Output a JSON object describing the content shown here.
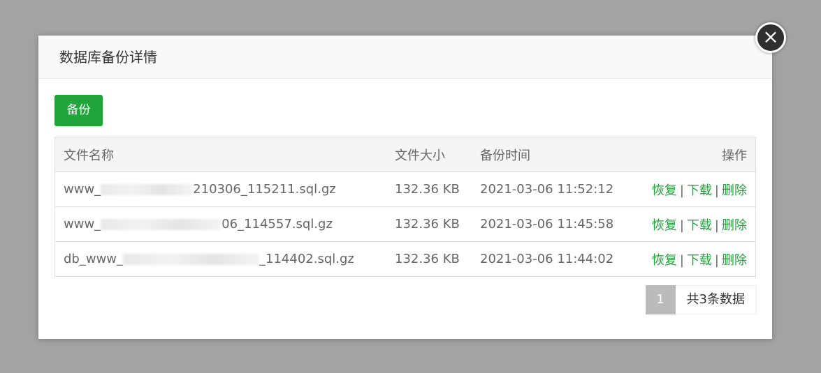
{
  "dialog": {
    "title": "数据库备份详情",
    "close_icon": "×"
  },
  "toolbar": {
    "backup_label": "备份"
  },
  "table": {
    "headers": {
      "name": "文件名称",
      "size": "文件大小",
      "time": "备份时间",
      "ops": "操作"
    },
    "rows": [
      {
        "name_prefix": "www_",
        "name_suffix": "210306_115211.sql.gz",
        "size": "132.36 KB",
        "time": "2021-03-06 11:52:12"
      },
      {
        "name_prefix": "www_",
        "name_suffix": "06_114557.sql.gz",
        "size": "132.36 KB",
        "time": "2021-03-06 11:45:58"
      },
      {
        "name_prefix": "db_www_",
        "name_suffix": "_114402.sql.gz",
        "size": "132.36 KB",
        "time": "2021-03-06 11:44:02"
      }
    ],
    "actions": {
      "restore": "恢复",
      "download": "下载",
      "delete": "删除",
      "separator": "|"
    }
  },
  "pagination": {
    "current_page": "1",
    "total_text": "共3条数据"
  },
  "colors": {
    "accent": "#20a53a",
    "overlay": "#a3a3a3",
    "pager_active": "#bbbbbb"
  }
}
